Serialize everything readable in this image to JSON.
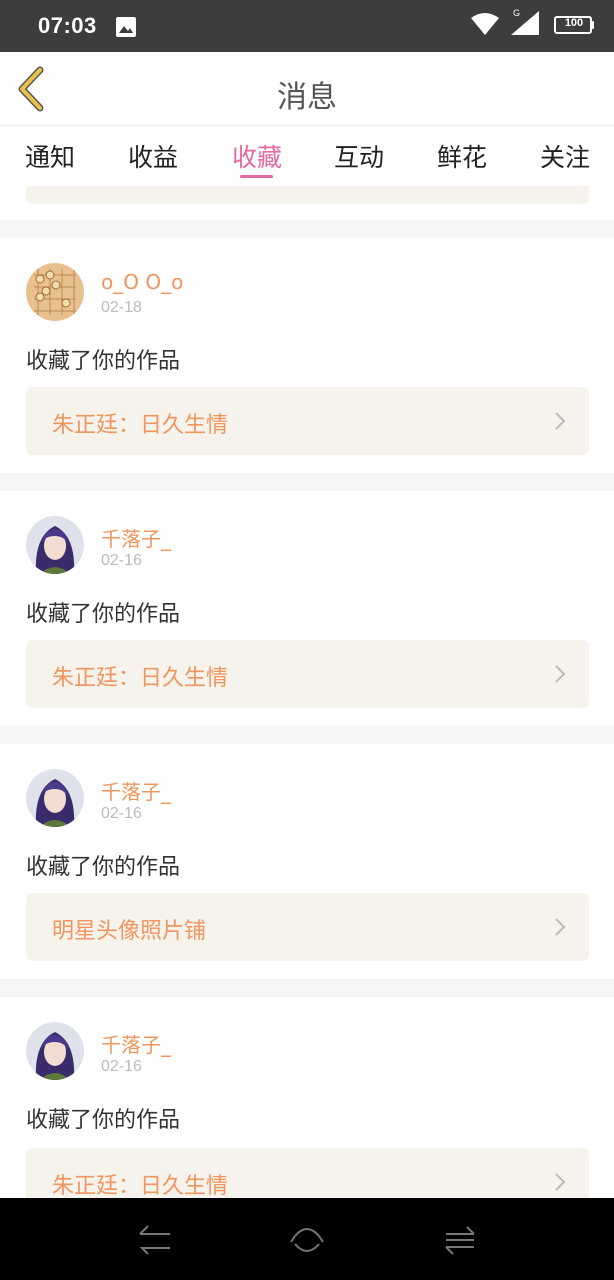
{
  "status": {
    "time": "07:03",
    "network": "G",
    "battery": "100"
  },
  "header": {
    "title": "消息"
  },
  "tabs": [
    {
      "label": "通知",
      "active": false
    },
    {
      "label": "收益",
      "active": false
    },
    {
      "label": "收藏",
      "active": true
    },
    {
      "label": "互动",
      "active": false
    },
    {
      "label": "鲜花",
      "active": false
    },
    {
      "label": "关注",
      "active": false
    }
  ],
  "items": [
    {
      "username": "o_O O_o",
      "date": "02-18",
      "action": "收藏了你的作品",
      "work": "朱正廷：日久生情",
      "avatar": "chess-board"
    },
    {
      "username": "千落子_",
      "date": "02-16",
      "action": "收藏了你的作品",
      "work": "朱正廷：日久生情",
      "avatar": "portrait"
    },
    {
      "username": "千落子_",
      "date": "02-16",
      "action": "收藏了你的作品",
      "work": "明星头像照片铺",
      "avatar": "portrait"
    },
    {
      "username": "千落子_",
      "date": "02-16",
      "action": "收藏了你的作品",
      "work": "朱正廷：日久生情",
      "avatar": "portrait"
    }
  ],
  "colors": {
    "accent": "#e36aa3",
    "username": "#f0955e",
    "work_bg": "#f5f3ec",
    "back_icon": "#e8c24a"
  }
}
